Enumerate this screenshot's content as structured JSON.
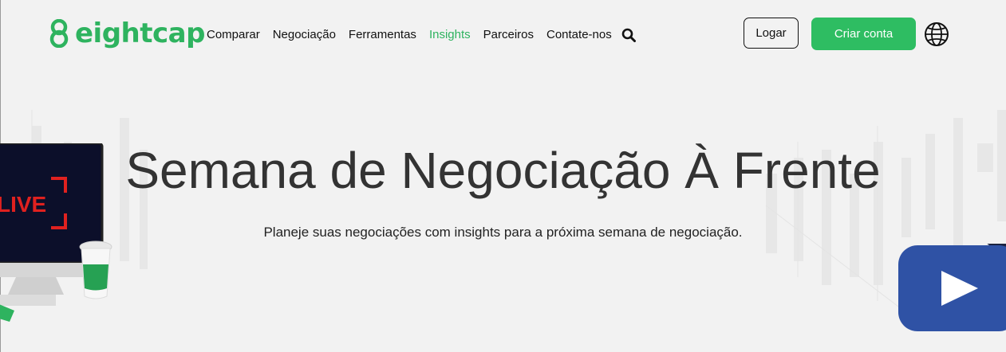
{
  "brand": {
    "name": "eightcap",
    "accent_color": "#2eb35f"
  },
  "nav": {
    "items": [
      {
        "label": "Comparar",
        "active": false
      },
      {
        "label": "Negociação",
        "active": false
      },
      {
        "label": "Ferramentas",
        "active": false
      },
      {
        "label": "Insights",
        "active": true
      },
      {
        "label": "Parceiros",
        "active": false
      },
      {
        "label": "Contate-nos",
        "active": false
      }
    ],
    "search_icon": "search-icon"
  },
  "actions": {
    "login_label": "Logar",
    "signup_label": "Criar conta",
    "language_icon": "globe-icon"
  },
  "hero": {
    "title": "Semana de Negociação À Frente",
    "subtitle": "Planeje suas negociações com insights para a próxima semana de negociação.",
    "monitor_text": "LIVE",
    "play_icon": "play-icon",
    "play_color": "#2f52a5"
  }
}
